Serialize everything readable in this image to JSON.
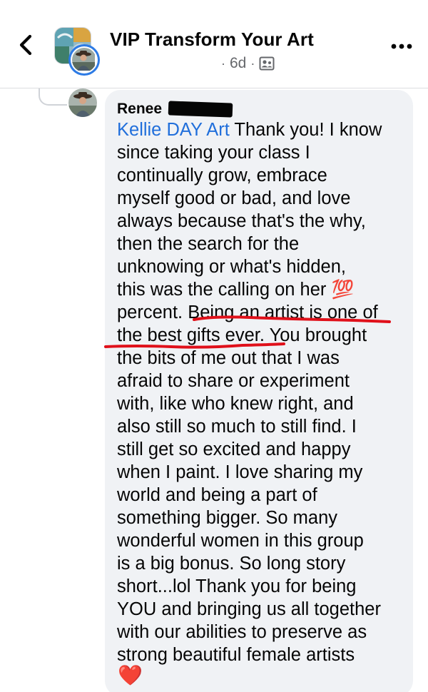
{
  "header": {
    "group_name": "VIP Transform Your Art",
    "time_ago": "6d",
    "separator": "·"
  },
  "comment": {
    "author_first": "Renee",
    "mention": "Kellie DAY Art",
    "lines": [
      " Thank you! I know",
      "since taking your class I",
      "continually grow, embrace",
      "myself good or bad, and love",
      "always because that's the why,",
      "then the search for the",
      "unknowing or what's hidden,",
      "this was the calling on her 💯",
      "percent. Being an artist is one of",
      "the best gifts ever. You brought",
      "the bits of me out that I was",
      "afraid to share or experiment",
      "with, like who knew right, and",
      "also still so much to still find. I",
      "still get so excited and happy",
      "when I paint. I love sharing my",
      "world and being a part of",
      "something bigger. So many",
      "wonderful women in this group",
      "is a big bonus. So long story",
      "short...lol Thank you for being",
      "YOU and bringing us all together",
      "with our abilities to preserve as",
      "strong beautiful female artists"
    ],
    "reaction": "❤️"
  },
  "colors": {
    "mention_blue": "#216fdb",
    "bubble_bg": "#f0f2f5",
    "annotation_red": "#e0101a",
    "avatar_ring": "#2d7be5"
  },
  "icons": {
    "back": "chevron-left-icon",
    "more": "more-horizontal-icon",
    "privacy": "members-icon"
  }
}
